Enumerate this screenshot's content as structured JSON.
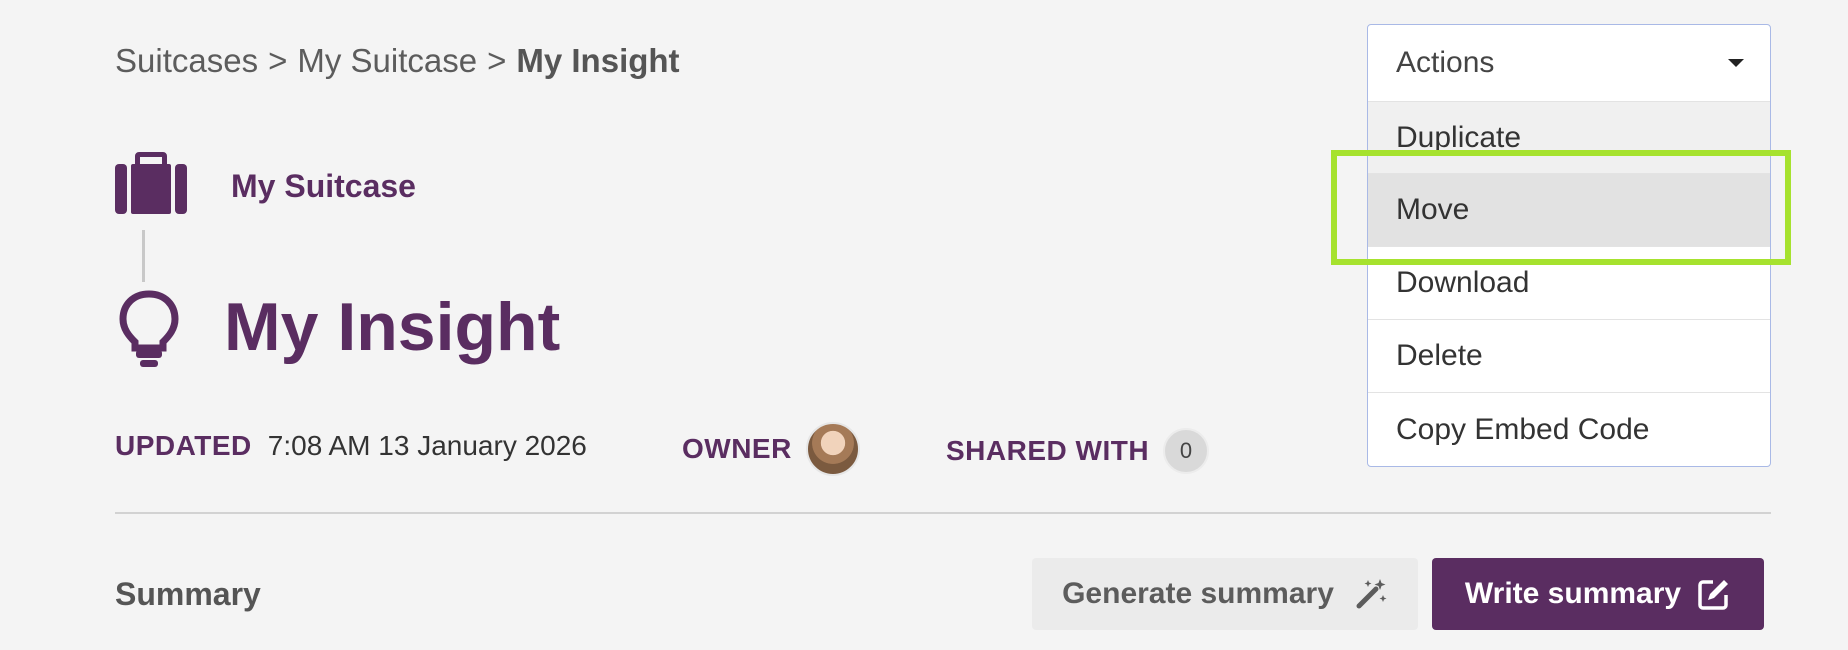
{
  "breadcrumb": {
    "items": [
      "Suitcases",
      "My Suitcase",
      "My Insight"
    ],
    "separator": ">"
  },
  "parent": {
    "label": "My Suitcase",
    "icon": "suitcase-icon"
  },
  "page": {
    "title": "My Insight",
    "icon": "lightbulb-icon"
  },
  "meta": {
    "updated_label": "UPDATED",
    "updated_value": "7:08 AM 13 January 2026",
    "owner_label": "OWNER",
    "shared_label": "SHARED WITH",
    "shared_count": "0"
  },
  "summary": {
    "heading": "Summary",
    "generate_label": "Generate summary",
    "write_label": "Write summary"
  },
  "actions": {
    "label": "Actions",
    "items": [
      "Duplicate",
      "Move",
      "Download",
      "Delete",
      "Copy Embed Code"
    ],
    "hovered": "Move"
  },
  "colors": {
    "brand": "#5a2d61",
    "background": "#f4f4f4",
    "highlight": "#a6e22e"
  }
}
